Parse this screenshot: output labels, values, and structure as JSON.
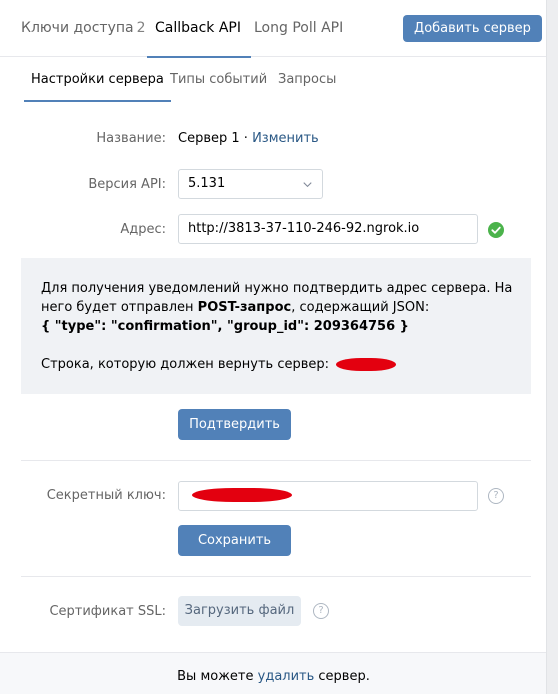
{
  "top_tabs": {
    "access_keys_label": "Ключи доступа",
    "access_keys_count": "2",
    "callback_label": "Callback API",
    "longpoll_label": "Long Poll API"
  },
  "add_server_label": "Добавить сервер",
  "sub_tabs": {
    "settings": "Настройки сервера",
    "event_types": "Типы событий",
    "requests": "Запросы"
  },
  "form": {
    "name_label": "Название:",
    "name_value": "Сервер 1",
    "name_separator": " · ",
    "name_change_link": "Изменить",
    "version_label": "Версия API:",
    "version_value": "5.131",
    "address_label": "Адрес:",
    "address_value": "http://3813-37-110-246-92.ngrok.io"
  },
  "confirm_box": {
    "text_part1": "Для получения уведомлений нужно подтвердить адрес сервера. На него будет отправлен ",
    "text_bold": "POST-запрос",
    "text_part2": ", содержащий JSON:",
    "json_text": "{ \"type\": \"confirmation\", \"group_id\": 209364756 }",
    "return_string_label": "Строка, которую должен вернуть сервер:"
  },
  "confirm_button_label": "Подтвердить",
  "secret_key": {
    "label": "Секретный ключ:",
    "help": "?"
  },
  "save_button_label": "Сохранить",
  "ssl": {
    "label": "Сертификат SSL:",
    "upload_label": "Загрузить файл",
    "help": "?"
  },
  "footer": {
    "text_before": "Вы можете ",
    "delete_link": "удалить",
    "text_after": " сервер."
  },
  "colors": {
    "accent": "#5181b8",
    "link": "#2a5885",
    "success": "#4bb34b",
    "redaction": "#e3000f"
  },
  "icons": {
    "version_dropdown": "chevron-down-icon",
    "address_status": "checkmark-circle-icon",
    "help": "question-circle-icon"
  }
}
